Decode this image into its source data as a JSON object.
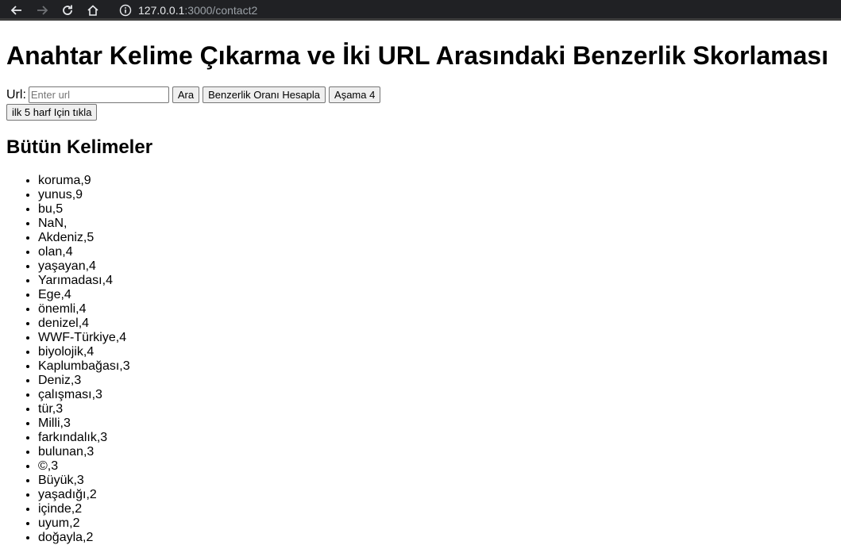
{
  "browser": {
    "url_host": "127.0.0.1",
    "url_path": ":3000/contact2"
  },
  "page": {
    "title": "Anahtar Kelime Çıkarma ve İki URL Arasındaki Benzerlik Skorlaması",
    "url_label": "Url:",
    "url_placeholder": "Enter url",
    "buttons": {
      "search": "Ara",
      "similarity": "Benzerlik Oranı Hesapla",
      "stage4": "Aşama 4",
      "first5": "ilk 5 harf Için tıkla"
    },
    "words_heading": "Bütün Kelimeler",
    "words": [
      "koruma,9",
      "yunus,9",
      "bu,5",
      "NaN,",
      "Akdeniz,5",
      "olan,4",
      "yaşayan,4",
      "Yarımadası,4",
      "Ege,4",
      "önemli,4",
      "denizel,4",
      "WWF-Türkiye,4",
      "biyolojik,4",
      "Kaplumbağası,3",
      "Deniz,3",
      "çalışması,3",
      "tür,3",
      "Milli,3",
      "farkındalık,3",
      "bulunan,3",
      "©,3",
      "Büyük,3",
      "yaşadığı,2",
      "içinde,2",
      "uyum,2",
      "doğayla,2"
    ]
  }
}
